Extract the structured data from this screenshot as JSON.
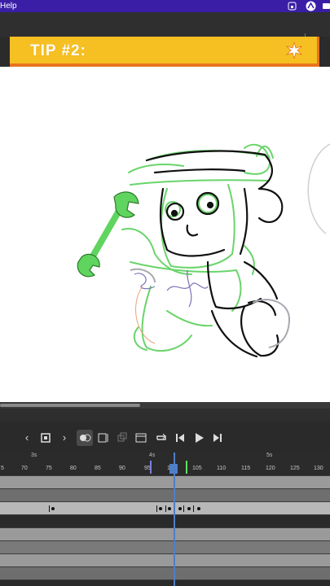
{
  "app": {
    "menubar": {
      "help_label": "Help",
      "bg_color": "#3a1fa6"
    }
  },
  "banner": {
    "title": "TIP #2:",
    "bg_color": "#f6c022",
    "accent_color": "#e8731e"
  },
  "timeline": {
    "seconds": [
      "3s",
      "4s",
      "5s"
    ],
    "frame_numbers": [
      "5",
      "70",
      "75",
      "80",
      "85",
      "90",
      "95",
      "100",
      "105",
      "110",
      "115",
      "120",
      "125",
      "130"
    ],
    "playhead_color": "#4e7fc9"
  },
  "toolbar": {
    "icons": [
      "chevron-left-icon",
      "stop-icon",
      "chevron-right-icon",
      "onion-skin-icon",
      "onion-skin-outline-icon",
      "edit-multiple-frames-icon",
      "frame-icon",
      "loop-icon",
      "step-back-icon",
      "play-icon",
      "step-forward-icon"
    ]
  }
}
